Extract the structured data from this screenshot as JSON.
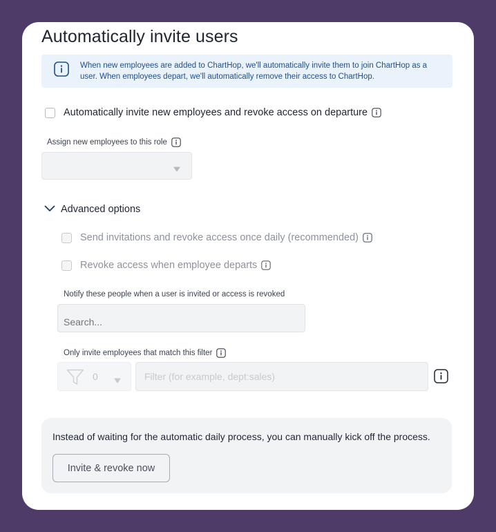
{
  "title": "Automatically invite users",
  "info_banner": {
    "text": "When new employees are added to ChartHop, we'll automatically invite them to join ChartHop as a user. When employees depart, we'll automatically remove their access to ChartHop."
  },
  "auto_invite": {
    "label": "Automatically invite new employees and revoke access on departure",
    "checked": false
  },
  "role": {
    "label": "Assign new employees to this role",
    "value": ""
  },
  "advanced": {
    "label": "Advanced options",
    "expanded": true,
    "daily": {
      "label": "Send invitations and revoke access once daily (recommended)",
      "checked": false
    },
    "revoke": {
      "label": "Revoke access when employee departs",
      "checked": false
    },
    "notify": {
      "label": "Notify these people when a user is invited or access is revoked",
      "placeholder": "Search..."
    },
    "filter": {
      "label": "Only invite employees that match this filter",
      "count": "0",
      "placeholder": "Filter (for example, dept:sales)"
    }
  },
  "manual": {
    "text": "Instead of waiting for the automatic daily process, you can manually kick off the process.",
    "button_label": "Invite & revoke now"
  },
  "colors": {
    "background": "#4f3b68",
    "card": "#ffffff",
    "info_bg": "#eaf2fb",
    "info_text": "#1f4f8a",
    "text": "#1f2533"
  },
  "icons": {
    "info": "info-icon",
    "chevron": "chevron-down-icon",
    "caret": "caret-down-icon",
    "funnel": "funnel-icon"
  }
}
